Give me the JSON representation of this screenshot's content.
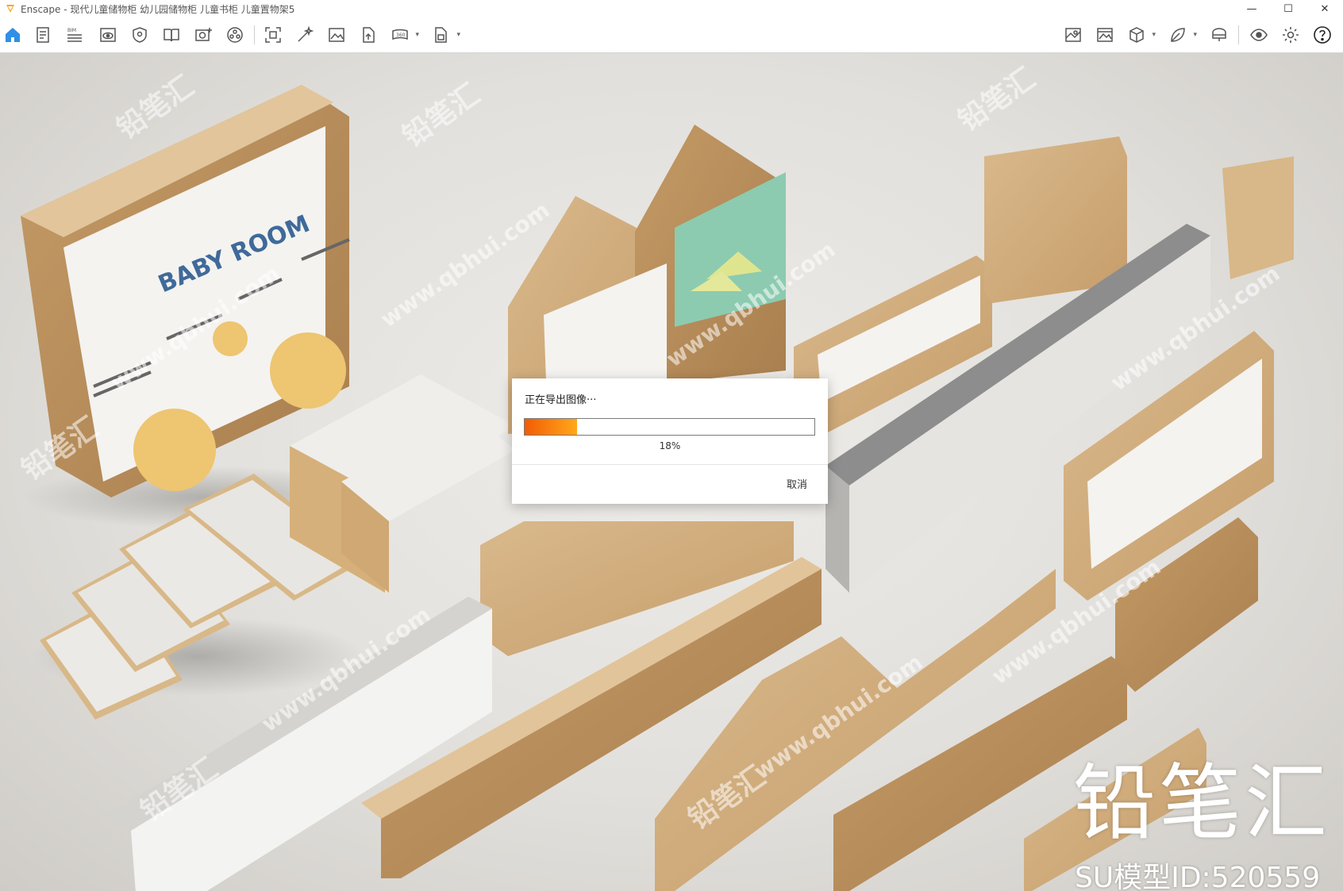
{
  "window": {
    "app_name": "Enscape",
    "title": "Enscape - 现代儿童储物柜 幼儿园储物柜 儿童书柜 儿童置物架5",
    "controls": [
      "—",
      "☐",
      "✕"
    ]
  },
  "toolbar": {
    "left_icons": [
      "home-icon",
      "document-icon",
      "bim-icon",
      "view-eye-icon",
      "shield-icon",
      "book-icon",
      "camera-plus-icon",
      "asset-library-icon",
      "screenshot-icon",
      "magic-wand-icon",
      "image-export-icon",
      "file-export-icon",
      "panorama-icon",
      "batch-export-icon"
    ],
    "right_icons": [
      "map-icon",
      "image-icon",
      "cube-icon",
      "leaf-icon",
      "vr-headset-icon",
      "visibility-icon",
      "settings-icon",
      "help-icon"
    ],
    "bim_label": "BIM",
    "collapse_glyph": "^"
  },
  "scene": {
    "sign_text": "BABY ROOM",
    "brand": "铅笔汇",
    "model_id": "SU模型ID:520559",
    "watermark_url": "www.qbhui.com",
    "watermark_cn": "铅笔汇"
  },
  "dialog": {
    "message": "正在导出图像···",
    "progress": 0.18,
    "progress_text": "18%",
    "cancel_label": "取消",
    "colors": {
      "fill_start": "#f25c05",
      "fill_end": "#ffa81a"
    }
  }
}
